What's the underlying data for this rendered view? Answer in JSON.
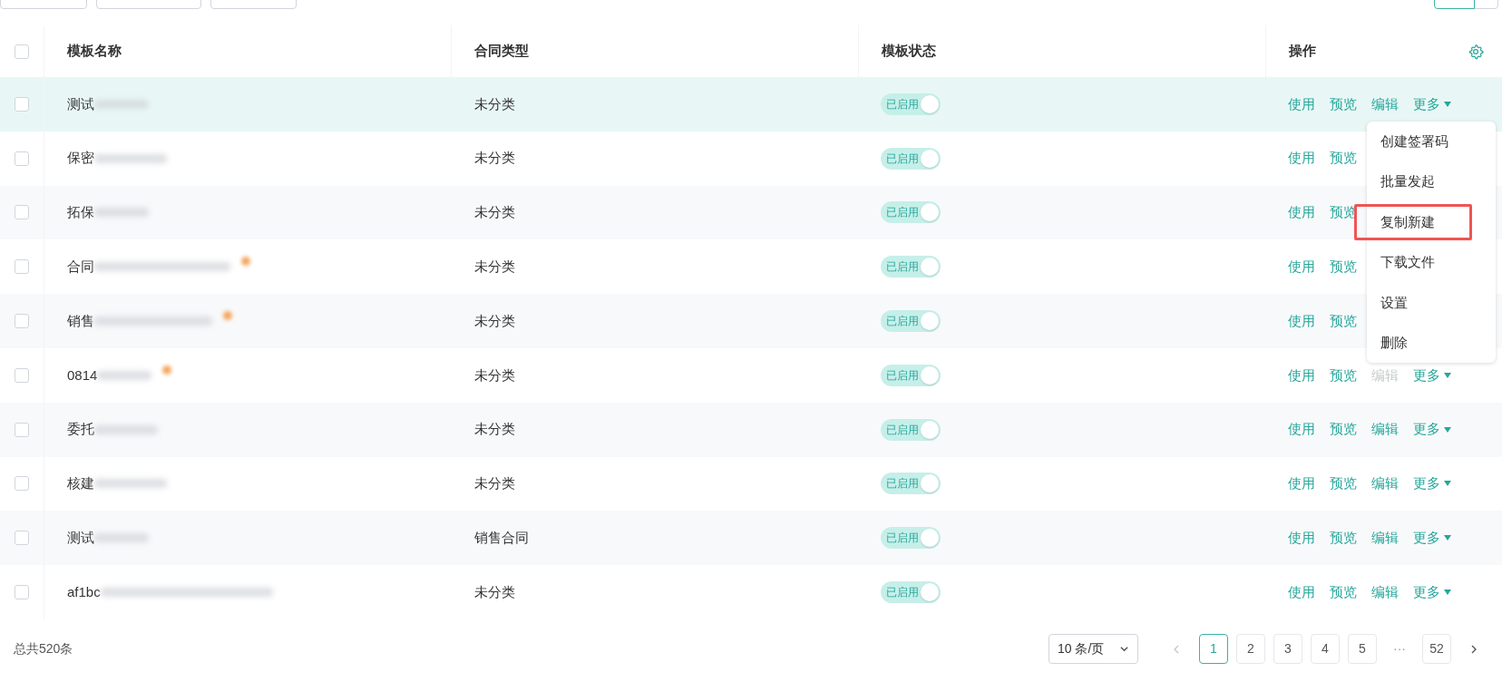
{
  "view_switch": [
    {
      "selected": true
    },
    {
      "selected": false
    }
  ],
  "table": {
    "select_all": {
      "checked": false
    },
    "columns": [
      "模板名称",
      "合同类型",
      "模板状态",
      "操作"
    ],
    "rows": [
      {
        "checked": false,
        "name": "测试",
        "type": "未分类",
        "status": {
          "label": "已启用",
          "on": true
        },
        "hovered": true,
        "flagged": false,
        "actions": [
          {
            "kind": "link",
            "label": "使用",
            "disabled": false
          },
          {
            "kind": "link",
            "label": "预览",
            "disabled": false
          },
          {
            "kind": "link",
            "label": "编辑",
            "disabled": false
          },
          {
            "kind": "more",
            "label": "更多",
            "disabled": false
          }
        ]
      },
      {
        "checked": false,
        "name": "保密",
        "type": "未分类",
        "status": {
          "label": "已启用",
          "on": true
        },
        "hovered": false,
        "flagged": false,
        "actions": [
          {
            "kind": "link",
            "label": "使用",
            "disabled": false
          },
          {
            "kind": "link",
            "label": "预览",
            "disabled": false
          }
        ]
      },
      {
        "checked": false,
        "name": "拓保",
        "type": "未分类",
        "status": {
          "label": "已启用",
          "on": true
        },
        "hovered": false,
        "flagged": false,
        "actions": [
          {
            "kind": "link",
            "label": "使用",
            "disabled": false
          },
          {
            "kind": "link",
            "label": "预览",
            "disabled": false
          }
        ]
      },
      {
        "checked": false,
        "name": "合同",
        "type": "未分类",
        "status": {
          "label": "已启用",
          "on": true
        },
        "hovered": false,
        "flagged": true,
        "actions": [
          {
            "kind": "link",
            "label": "使用",
            "disabled": false
          },
          {
            "kind": "link",
            "label": "预览",
            "disabled": false
          }
        ]
      },
      {
        "checked": false,
        "name": "销售",
        "type": "未分类",
        "status": {
          "label": "已启用",
          "on": true
        },
        "hovered": false,
        "flagged": true,
        "actions": [
          {
            "kind": "link",
            "label": "使用",
            "disabled": false
          },
          {
            "kind": "link",
            "label": "预览",
            "disabled": false
          }
        ]
      },
      {
        "checked": false,
        "name": "0814",
        "type": "未分类",
        "status": {
          "label": "已启用",
          "on": true
        },
        "hovered": false,
        "flagged": true,
        "actions": [
          {
            "kind": "link",
            "label": "使用",
            "disabled": false
          },
          {
            "kind": "link",
            "label": "预览",
            "disabled": false
          },
          {
            "kind": "link",
            "label": "编辑",
            "disabled": true
          },
          {
            "kind": "more",
            "label": "更多",
            "disabled": false
          }
        ]
      },
      {
        "checked": false,
        "name": "委托",
        "type": "未分类",
        "status": {
          "label": "已启用",
          "on": true
        },
        "hovered": false,
        "flagged": false,
        "actions": [
          {
            "kind": "link",
            "label": "使用",
            "disabled": false
          },
          {
            "kind": "link",
            "label": "预览",
            "disabled": false
          },
          {
            "kind": "link",
            "label": "编辑",
            "disabled": false
          },
          {
            "kind": "more",
            "label": "更多",
            "disabled": false
          }
        ]
      },
      {
        "checked": false,
        "name": "核建",
        "type": "未分类",
        "status": {
          "label": "已启用",
          "on": true
        },
        "hovered": false,
        "flagged": false,
        "actions": [
          {
            "kind": "link",
            "label": "使用",
            "disabled": false
          },
          {
            "kind": "link",
            "label": "预览",
            "disabled": false
          },
          {
            "kind": "link",
            "label": "编辑",
            "disabled": false
          },
          {
            "kind": "more",
            "label": "更多",
            "disabled": false
          }
        ]
      },
      {
        "checked": false,
        "name": "测试",
        "type": "销售合同",
        "status": {
          "label": "已启用",
          "on": true
        },
        "hovered": false,
        "flagged": false,
        "actions": [
          {
            "kind": "link",
            "label": "使用",
            "disabled": false
          },
          {
            "kind": "link",
            "label": "预览",
            "disabled": false
          },
          {
            "kind": "link",
            "label": "编辑",
            "disabled": false
          },
          {
            "kind": "more",
            "label": "更多",
            "disabled": false
          }
        ]
      },
      {
        "checked": false,
        "name": "af1bc",
        "type": "未分类",
        "status": {
          "label": "已启用",
          "on": true
        },
        "hovered": false,
        "flagged": false,
        "actions": [
          {
            "kind": "link",
            "label": "使用",
            "disabled": false
          },
          {
            "kind": "link",
            "label": "预览",
            "disabled": false
          },
          {
            "kind": "link",
            "label": "编辑",
            "disabled": false
          },
          {
            "kind": "more",
            "label": "更多",
            "disabled": false
          }
        ]
      }
    ]
  },
  "more_menu": {
    "items": [
      {
        "label": "创建签署码",
        "highlighted": false
      },
      {
        "label": "批量发起",
        "highlighted": false
      },
      {
        "label": "复制新建",
        "highlighted": true
      },
      {
        "label": "下载文件",
        "highlighted": false
      },
      {
        "label": "设置",
        "highlighted": false
      },
      {
        "label": "删除",
        "highlighted": false
      }
    ]
  },
  "footer": {
    "total": "总共520条",
    "page_size": "10 条/页",
    "pages": [
      {
        "label": "1",
        "selected": true
      },
      {
        "label": "2",
        "selected": false
      },
      {
        "label": "3",
        "selected": false
      },
      {
        "label": "4",
        "selected": false
      },
      {
        "label": "5",
        "selected": false
      },
      {
        "kind": "ellipsis",
        "label": "···"
      },
      {
        "label": "52",
        "selected": false
      }
    ]
  }
}
